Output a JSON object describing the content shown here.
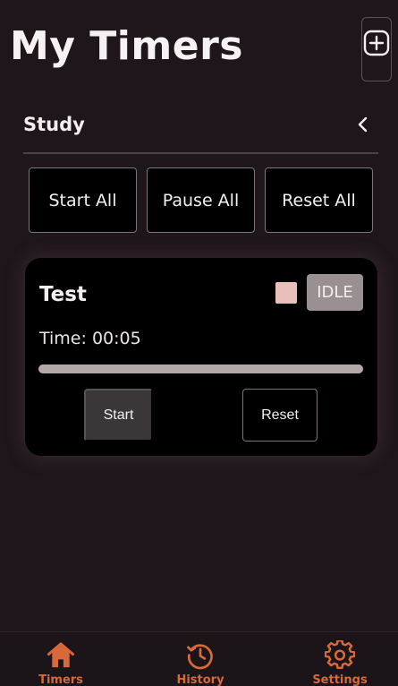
{
  "header": {
    "title": "My Timers",
    "add_icon": "plus-square-icon"
  },
  "group": {
    "name": "Study",
    "toggle_icon": "chevron-left-icon",
    "buttons": {
      "start_all": "Start All",
      "pause_all": "Pause All",
      "reset_all": "Reset All"
    }
  },
  "timers": [
    {
      "name": "Test",
      "color": "#e8c0bb",
      "status": "IDLE",
      "time_label": "Time: 00:05",
      "progress": 1.0,
      "start_label": "Start",
      "reset_label": "Reset"
    }
  ],
  "nav": {
    "items": [
      {
        "label": "Timers",
        "icon": "home-icon"
      },
      {
        "label": "History",
        "icon": "history-icon"
      },
      {
        "label": "Settings",
        "icon": "gear-icon"
      }
    ]
  },
  "colors": {
    "background": "#1f161b",
    "card": "#000000",
    "accent": "#d8693a",
    "progress": "#b4a9a8",
    "status_idle": "#9a9091"
  }
}
